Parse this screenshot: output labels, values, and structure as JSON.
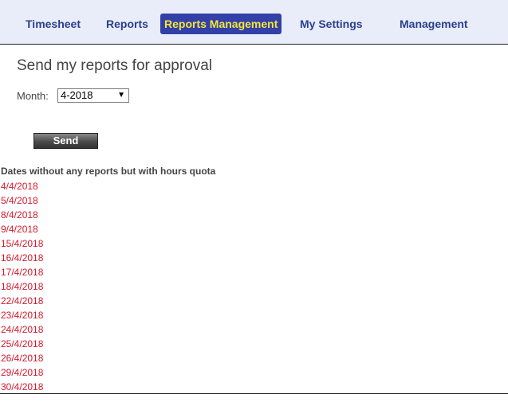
{
  "nav": {
    "items": [
      {
        "label": "Timesheet",
        "active": false
      },
      {
        "label": "Reports",
        "active": false
      },
      {
        "label": "Reports Management",
        "active": true
      },
      {
        "label": "My Settings",
        "active": false
      },
      {
        "label": "Management",
        "active": false
      }
    ],
    "colors": {
      "bar_background": "#e8edf9",
      "link": "#2b3f8f",
      "active_background": "#3340a8",
      "active_text": "#f5e63a"
    }
  },
  "page": {
    "title": "Send my reports for approval"
  },
  "month": {
    "label": "Month:",
    "selected": "4-2018",
    "dropdown_icon": "chevron-down-icon"
  },
  "send_button": {
    "label": "Send"
  },
  "missing_dates": {
    "heading": "Dates without any reports but with hours quota",
    "color": "#d4182a",
    "dates": [
      "4/4/2018",
      "5/4/2018",
      "8/4/2018",
      "9/4/2018",
      "15/4/2018",
      "16/4/2018",
      "17/4/2018",
      "18/4/2018",
      "22/4/2018",
      "23/4/2018",
      "24/4/2018",
      "25/4/2018",
      "26/4/2018",
      "29/4/2018",
      "30/4/2018"
    ]
  }
}
